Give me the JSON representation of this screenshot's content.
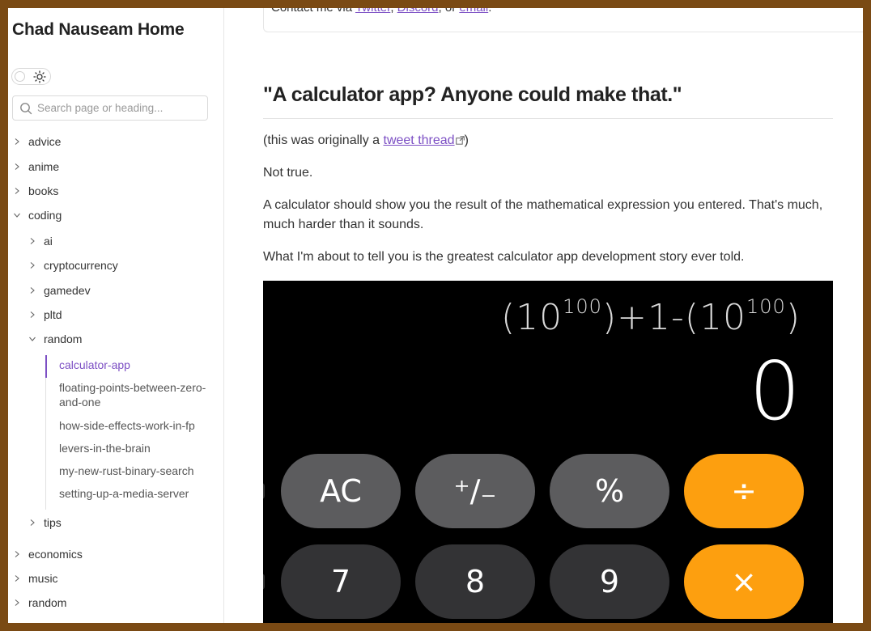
{
  "sidebar": {
    "site_title": "Chad Nauseam Home",
    "search_placeholder": "Search page or heading...",
    "top_items": [
      {
        "label": "advice",
        "expanded": false
      },
      {
        "label": "anime",
        "expanded": false
      },
      {
        "label": "books",
        "expanded": false
      },
      {
        "label": "coding",
        "expanded": true
      }
    ],
    "coding_children": [
      {
        "label": "ai",
        "expanded": false
      },
      {
        "label": "cryptocurrency",
        "expanded": false
      },
      {
        "label": "gamedev",
        "expanded": false
      },
      {
        "label": "pltd",
        "expanded": false
      },
      {
        "label": "random",
        "expanded": true
      }
    ],
    "random_pages": [
      {
        "label": "calculator-app",
        "active": true
      },
      {
        "label": "floating-points-between-zero-and-one",
        "active": false
      },
      {
        "label": "how-side-effects-work-in-fp",
        "active": false
      },
      {
        "label": "levers-in-the-brain",
        "active": false
      },
      {
        "label": "my-new-rust-binary-search",
        "active": false
      },
      {
        "label": "setting-up-a-media-server",
        "active": false
      }
    ],
    "tips_label": "tips",
    "bottom_items": [
      {
        "label": "economics",
        "expanded": false
      },
      {
        "label": "music",
        "expanded": false
      },
      {
        "label": "random",
        "expanded": false
      }
    ]
  },
  "main": {
    "contact": {
      "prefix": "Contact me via ",
      "twitter": "Twitter",
      "sep1": ", ",
      "discord": "Discord",
      "sep2": ", or ",
      "email": "email",
      "end": "."
    },
    "heading": "\"A calculator app? Anyone could make that.\"",
    "intro": {
      "prefix": "(this was originally a ",
      "link": "tweet thread",
      "suffix": ")"
    },
    "p1": "Not true.",
    "p2": "A calculator should show you the result of the mathematical expression you entered. That's much, much harder than it sounds.",
    "p3": "What I'm about to tell you is the greatest calculator app development story ever told."
  },
  "calculator_image": {
    "expression": {
      "a": "(10",
      "exp1": "100",
      "b": ")+1-(10",
      "exp2": "100",
      "c": ")"
    },
    "result": "0",
    "row1": [
      "AC",
      "⁺∕₋",
      "%",
      "÷"
    ],
    "row2": [
      "7",
      "8",
      "9",
      "×"
    ]
  },
  "colors": {
    "accent": "#7c4fc4",
    "operator_key": "#fd9f0f",
    "function_key": "#5c5c5e",
    "number_key": "#333335",
    "frame": "#7a4a14"
  }
}
